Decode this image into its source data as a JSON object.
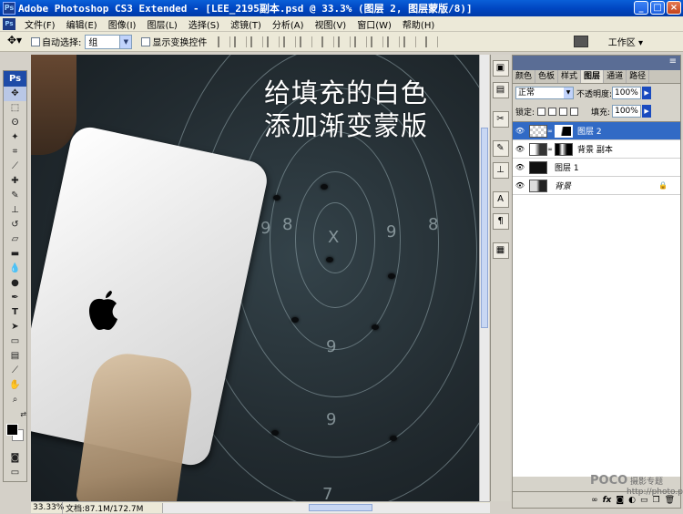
{
  "window": {
    "title": "Adobe Photoshop CS3 Extended - [LEE_2195副本.psd @ 33.3% (图层 2, 图层蒙版/8)]",
    "controls": [
      "_",
      "□",
      "×"
    ]
  },
  "menu": {
    "items": [
      "文件(F)",
      "编辑(E)",
      "图像(I)",
      "图层(L)",
      "选择(S)",
      "滤镜(T)",
      "分析(A)",
      "视图(V)",
      "窗口(W)",
      "帮助(H)"
    ]
  },
  "options": {
    "auto_select_label": "自动选择:",
    "auto_select_value": "组",
    "show_transform_label": "显示变换控件",
    "workspace_label": "工作区 ▾"
  },
  "canvas": {
    "overlay_line1": "给填充的白色",
    "overlay_line2": "添加渐变蒙版",
    "digits": [
      "9",
      "8",
      "X",
      "9",
      "8",
      "9",
      "9",
      "7"
    ]
  },
  "status": {
    "zoom": "33.33%",
    "doc": "文档:87.1M/172.7M"
  },
  "layers_panel": {
    "tabs": [
      "颜色",
      "色板",
      "样式",
      "图层",
      "通道",
      "路径"
    ],
    "active_tab": "图层",
    "blend_mode": "正常",
    "opacity_label": "不透明度:",
    "opacity_value": "100%",
    "lock_label": "锁定:",
    "fill_label": "填充:",
    "fill_value": "100%",
    "layers": [
      {
        "name": "图层 2",
        "selected": true
      },
      {
        "name": "背景 副本",
        "selected": false
      },
      {
        "name": "图层 1",
        "selected": false
      },
      {
        "name": "背景",
        "selected": false
      }
    ],
    "bottom_icons": [
      "link-icon",
      "fx-icon",
      "mask-icon",
      "adjustment-icon",
      "group-icon",
      "new-layer-icon",
      "trash-icon"
    ]
  },
  "watermark": {
    "brand": "POCO",
    "sub": "摄影专题",
    "url": "http://photo.poco.cn/"
  }
}
